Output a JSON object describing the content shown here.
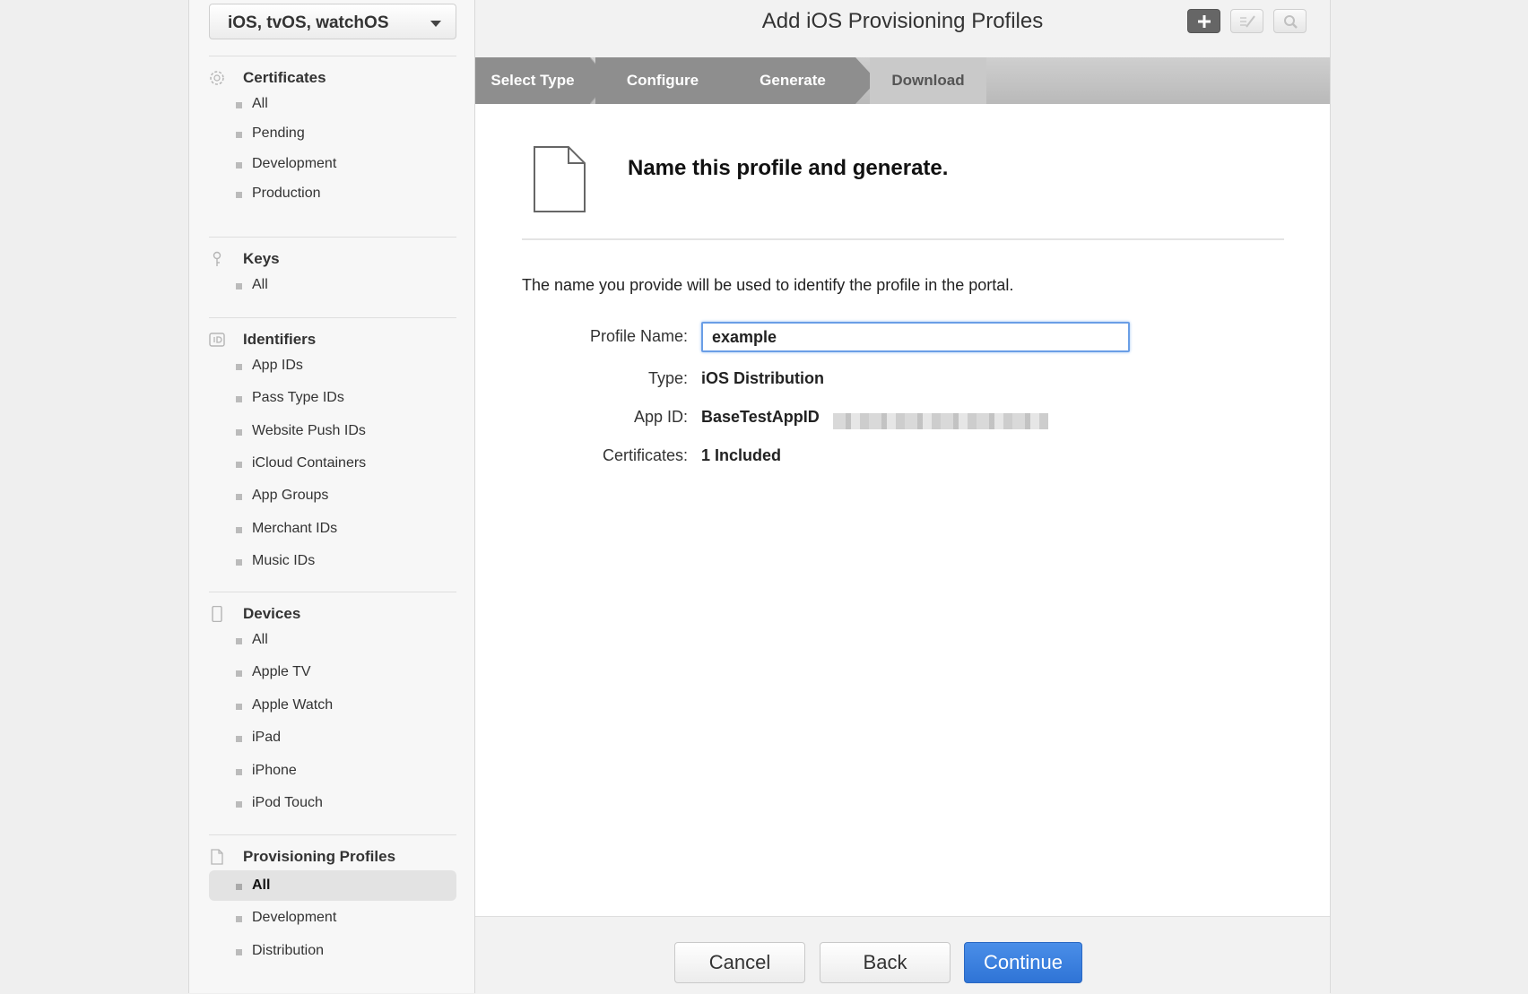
{
  "platform": {
    "selected": "iOS, tvOS, watchOS"
  },
  "sidebar": {
    "sections": [
      {
        "title": "Certificates",
        "icon": "certificate-icon",
        "items": [
          "All",
          "Pending",
          "Development",
          "Production"
        ]
      },
      {
        "title": "Keys",
        "icon": "key-icon",
        "items": [
          "All"
        ]
      },
      {
        "title": "Identifiers",
        "icon": "id-icon",
        "items": [
          "App IDs",
          "Pass Type IDs",
          "Website Push IDs",
          "iCloud Containers",
          "App Groups",
          "Merchant IDs",
          "Music IDs"
        ]
      },
      {
        "title": "Devices",
        "icon": "device-icon",
        "items": [
          "All",
          "Apple TV",
          "Apple Watch",
          "iPad",
          "iPhone",
          "iPod Touch"
        ]
      },
      {
        "title": "Provisioning Profiles",
        "icon": "profile-doc-icon",
        "items": [
          "All",
          "Development",
          "Distribution"
        ]
      }
    ],
    "selected": {
      "section": 4,
      "item": 0
    }
  },
  "header": {
    "title": "Add iOS Provisioning Profiles"
  },
  "steps": [
    "Select Type",
    "Configure",
    "Generate",
    "Download"
  ],
  "content": {
    "heading": "Name this profile and generate.",
    "intro": "The name you provide will be used to identify the profile in the portal.",
    "fields": {
      "profile_name_label": "Profile Name:",
      "profile_name_value": "example",
      "type_label": "Type:",
      "type_value": "iOS Distribution",
      "app_id_label": "App ID:",
      "app_id_value": "BaseTestAppID",
      "certificates_label": "Certificates:",
      "certificates_value": "1 Included"
    }
  },
  "footer": {
    "cancel": "Cancel",
    "back": "Back",
    "continue": "Continue"
  },
  "colors": {
    "accent": "#2f74d6",
    "step_active": "#8e8e8e",
    "step_inactive": "#c9c9c9"
  }
}
